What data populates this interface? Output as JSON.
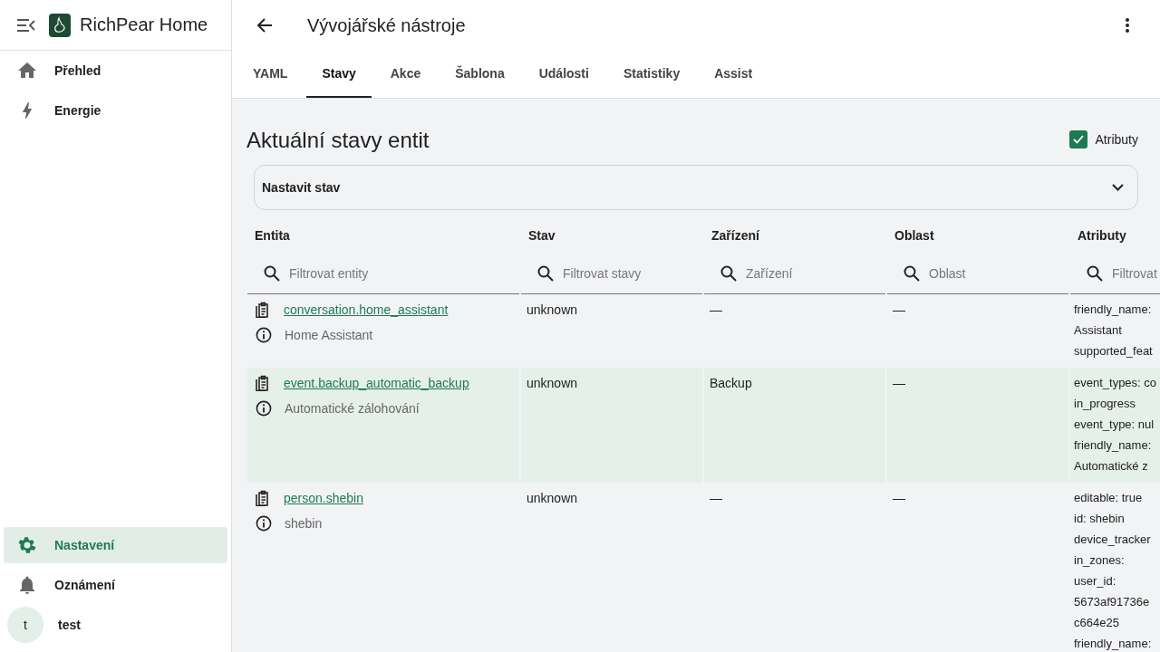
{
  "sidebar": {
    "title": "RichPear Home",
    "items": [
      {
        "label": "Přehled",
        "selected": false
      },
      {
        "label": "Energie",
        "selected": false
      }
    ],
    "bottom_items": [
      {
        "label": "Nastavení",
        "selected": true
      },
      {
        "label": "Oznámení",
        "selected": false
      }
    ],
    "user": {
      "initial": "t",
      "name": "test"
    }
  },
  "header": {
    "title": "Vývojářské nástroje"
  },
  "tabs": [
    {
      "label": "YAML",
      "selected": false
    },
    {
      "label": "Stavy",
      "selected": true
    },
    {
      "label": "Akce",
      "selected": false
    },
    {
      "label": "Šablona",
      "selected": false
    },
    {
      "label": "Události",
      "selected": false
    },
    {
      "label": "Statistiky",
      "selected": false
    },
    {
      "label": "Assist",
      "selected": false
    }
  ],
  "section": {
    "title": "Aktuální stavy entit",
    "attributes_toggle": {
      "label": "Atributy",
      "checked": true
    }
  },
  "set_state_panel": {
    "label": "Nastavit stav",
    "expanded": false
  },
  "table": {
    "columns": [
      {
        "label": "Entita",
        "placeholder": "Filtrovat entity"
      },
      {
        "label": "Stav",
        "placeholder": "Filtrovat stavy"
      },
      {
        "label": "Zařízení",
        "placeholder": "Zařízení"
      },
      {
        "label": "Oblast",
        "placeholder": "Oblast"
      },
      {
        "label": "Atributy",
        "placeholder": "Filtrovat"
      }
    ],
    "rows": [
      {
        "entity_id": "conversation.home_assistant",
        "name": "Home Assistant",
        "state": "unknown",
        "device": "—",
        "area": "—",
        "attributes": [
          "friendly_name:",
          "Assistant",
          "supported_feat"
        ]
      },
      {
        "entity_id": "event.backup_automatic_backup",
        "name": "Automatické zálohování",
        "state": "unknown",
        "device": "Backup",
        "area": "—",
        "attributes": [
          "event_types: co",
          "in_progress",
          "event_type: nul",
          "friendly_name:",
          "Automatické z"
        ]
      },
      {
        "entity_id": "person.shebin",
        "name": "shebin",
        "state": "unknown",
        "device": "—",
        "area": "—",
        "attributes": [
          "editable: true",
          "id: shebin",
          "device_tracker",
          "in_zones:",
          "user_id:",
          "5673af91736e",
          "c664e25",
          "friendly_name:"
        ]
      }
    ]
  }
}
